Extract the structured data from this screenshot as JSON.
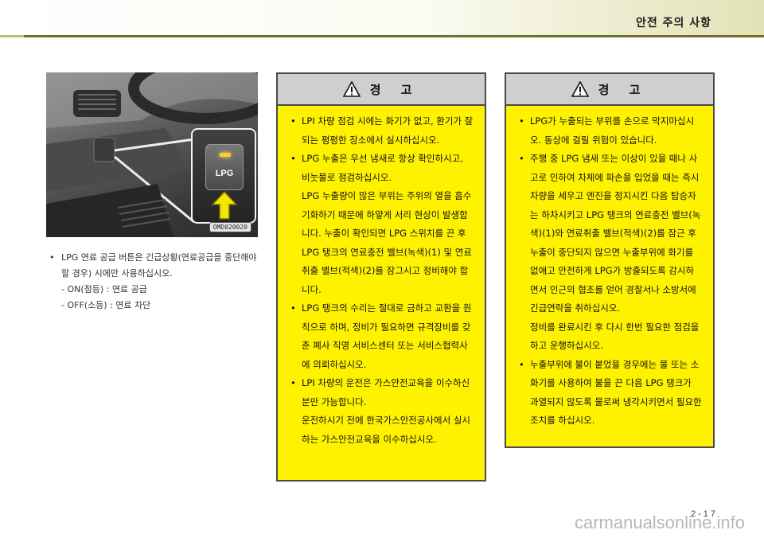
{
  "header": {
    "title": "안전 주의 사항"
  },
  "photo": {
    "code": "OMD020020",
    "button_label": "LPG"
  },
  "notes": {
    "items": [
      "LPG 연료 공급 버튼은 긴급상황(연료공급을 중단해야 할 경우) 시에만 사용하십시오."
    ],
    "sub_items": [
      "- ON(점등) : 연료 공급",
      "- OFF(소등) : 연료 차단"
    ]
  },
  "warning_left": {
    "title": "경 고",
    "items": [
      [
        "LPI 차량 점검 시에는 화기가 없고, 환기가 잘 되는 평평한 장소에서 실시하십시오."
      ],
      [
        "LPG 누출은 우선 냄새로 항상 확인하시고, 비눗물로 점검하십시오.",
        "LPG 누출량이 많은 부위는 주위의 열을 흡수기화하기 때문에 하얗게 서리 현상이 발생합니다. 누출이 확인되면 LPG 스위치를 끈 후 LPG 탱크의 연료충전 밸브(녹색)(1) 및 연료취출 밸브(적색)(2)를 잠그시고 정비해야 합니다."
      ],
      [
        "LPG 탱크의 수리는 절대로 금하고 교환을 원칙으로 하며, 정비가 필요하면 규격장비를 갖춘 폐사 직영 서비스센터 또는 서비스협력사에 의뢰하십시오."
      ],
      [
        "LPI 차량의 운전은 가스안전교육을 이수하신 분만 가능합니다.",
        "운전하시기 전에 한국가스안전공사에서 실시하는 가스안전교육을 이수하십시오."
      ]
    ]
  },
  "warning_right": {
    "title": "경 고",
    "items": [
      [
        "LPG가 누출되는 부위를 손으로 막지마십시오. 동상에 걸릴 위험이 있습니다."
      ],
      [
        "주행 중 LPG 냄새 또는 이상이 있을 때나 사고로 인하여 차체에 파손을 입었을 때는 즉시 차량을 세우고 엔진을 정지시킨 다음 탑승자는 하차시키고 LPG 탱크의 연료충전 밸브(녹색)(1)와 연료취출 밸브(적색)(2)를 잠근 후 누출이 중단되지 않으면 누출부위에 화기를 없애고 안전하게 LPG가 방출되도록 감시하면서 인근의 협조를 얻어 경찰서나 소방서에 긴급연락을 취하십시오.",
        "정비를 완료시킨 후 다시 한번 필요한 점검을 하고 운행하십시오."
      ],
      [
        "누출부위에 불이 붙었을 경우에는 물 또는 소화기를 사용하여 불을 끈 다음 LPG 탱크가 과열되지 않도록 물로써 냉각시키면서 필요한 조치를 하십시오."
      ]
    ]
  },
  "page_number": "2-17",
  "watermark": "carmanualsonline.info",
  "colors": {
    "warning_fill": "#fff200",
    "warning_header": "#cfcfcf",
    "header_rule": "#6e6e28"
  }
}
